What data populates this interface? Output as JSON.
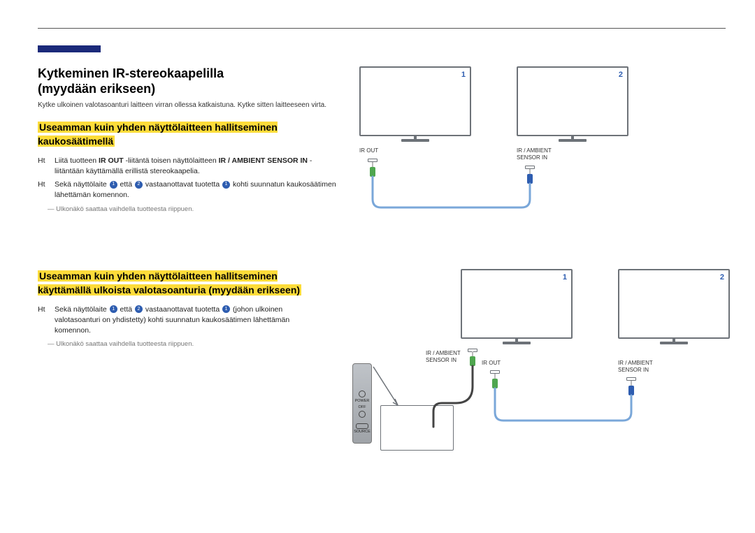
{
  "title_line1": "Kytkeminen IR-stereokaapelilla",
  "title_line2": "(myydään erikseen)",
  "intro": "Kytke ulkoinen valotasoanturi laitteen virran ollessa katkaistuna. Kytke sitten laitteeseen virta.",
  "sect1_heading": "Useamman kuin yhden näyttölaitteen hallitseminen kaukosäätimellä",
  "sect1_step1_pre": "Liitä tuotteen ",
  "sect1_step1_b1": "IR OUT",
  "sect1_step1_mid": " -liitäntä toisen näyttölaitteen ",
  "sect1_step1_b2": "IR / AMBIENT SENSOR IN",
  "sect1_step1_tail": " -liitäntään käyttämällä erillistä stereokaapelia.",
  "sect1_step2_a": "Sekä näyttölaite ",
  "sect1_step2_b": " että ",
  "sect1_step2_c": " vastaanottavat tuotetta ",
  "sect1_step2_d": " kohti suunnatun kaukosäätimen lähettämän komennon.",
  "note_text": "Ulkonäkö saattaa vaihdella tuotteesta riippuen.",
  "sect2_heading": "Useamman kuin yhden näyttölaitteen hallitseminen käyttämällä ulkoista valotasoanturia (myydään erikseen)",
  "sect2_step_a": "Sekä näyttölaite ",
  "sect2_step_b": " että ",
  "sect2_step_c": " vastaanottavat tuotetta ",
  "sect2_step_d": " (johon ulkoinen valotasoanturi on yhdistetty) kohti suunnatun kaukosäätimen lähettämän komennon.",
  "labels": {
    "ir_out": "IR OUT",
    "ir_amb": "IR / AMBIENT",
    "sensor_in": "SENSOR IN",
    "power": "POWER",
    "off": "OFF",
    "source": "SOURCE"
  },
  "nums": {
    "one": "1",
    "two": "2"
  },
  "ht": "Ht"
}
